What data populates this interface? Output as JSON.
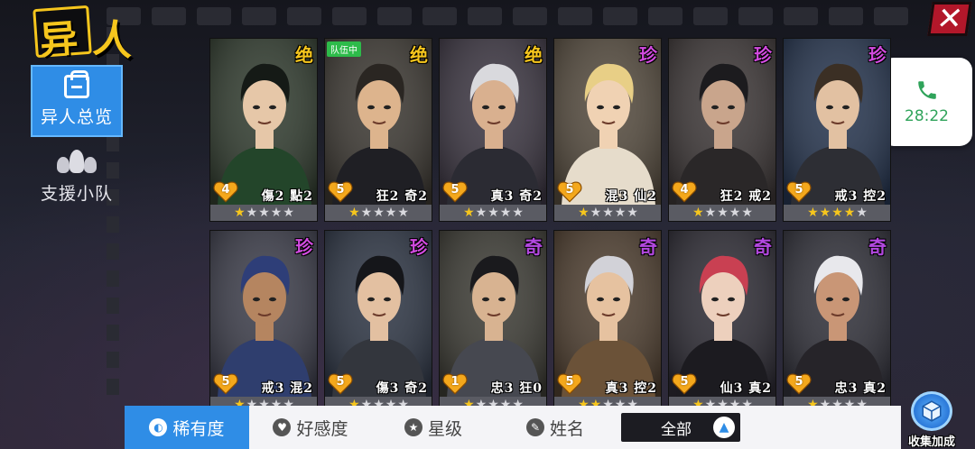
{
  "logo": {
    "char1": "异",
    "char2": "人"
  },
  "sidebar": {
    "items": [
      {
        "label": "异人总览",
        "icon": "document-icon",
        "active": true
      },
      {
        "label": "支援小队",
        "icon": "group-icon",
        "active": false
      }
    ]
  },
  "call_widget": {
    "time": "28:22",
    "icon": "phone-icon"
  },
  "close": {
    "label": "✕"
  },
  "colors": {
    "accent": "#2f8de6",
    "rarity_jue": "#f6c61d",
    "rarity_zhen": "#d24be0",
    "rarity_qi": "#b348e0",
    "star_on": "#f6c61d",
    "star_off": "#d9d9de",
    "team_badge": "#2dbb4a"
  },
  "cards": [
    {
      "rarity": "绝",
      "team_badge": "",
      "affection": "4",
      "skills": "傷2 點2",
      "stars": 1,
      "palette": {
        "bg": "#2f3a2d",
        "hair": "#151a16",
        "skin": "#e6c7a8",
        "cloth": "#23452a"
      }
    },
    {
      "rarity": "绝",
      "team_badge": "队伍中",
      "affection": "5",
      "skills": "狂2 奇2",
      "stars": 1,
      "palette": {
        "bg": "#3a3630",
        "hair": "#2a2622",
        "skin": "#ddb48d",
        "cloth": "#1f1f24"
      }
    },
    {
      "rarity": "绝",
      "team_badge": "",
      "affection": "5",
      "skills": "真3 奇2",
      "stars": 1,
      "palette": {
        "bg": "#3a3440",
        "hair": "#d9d9dd",
        "skin": "#d9b08f",
        "cloth": "#2b2b33"
      }
    },
    {
      "rarity": "珍",
      "team_badge": "",
      "affection": "5",
      "skills": "混3 仙2",
      "stars": 1,
      "palette": {
        "bg": "#53493c",
        "hair": "#e8cf86",
        "skin": "#f0d2b3",
        "cloth": "#e6dccb"
      }
    },
    {
      "rarity": "珍",
      "team_badge": "",
      "affection": "4",
      "skills": "狂2 戒2",
      "stars": 1,
      "palette": {
        "bg": "#3b3535",
        "hair": "#1c1b1e",
        "skin": "#c9a58c",
        "cloth": "#2a2728"
      }
    },
    {
      "rarity": "珍",
      "team_badge": "",
      "affection": "5",
      "skills": "戒3 控2",
      "stars": 4,
      "palette": {
        "bg": "#24334d",
        "hair": "#3b2f24",
        "skin": "#e2c1a2",
        "cloth": "#2d2e34"
      }
    },
    {
      "rarity": "珍",
      "team_badge": "",
      "affection": "5",
      "skills": "戒3 混2",
      "stars": 1,
      "palette": {
        "bg": "#3a3b48",
        "hair": "#2e3e78",
        "skin": "#b58560",
        "cloth": "#2f3e6e"
      }
    },
    {
      "rarity": "珍",
      "team_badge": "",
      "affection": "5",
      "skills": "傷3 奇2",
      "stars": 1,
      "palette": {
        "bg": "#2c3443",
        "hair": "#15161a",
        "skin": "#e3c0a1",
        "cloth": "#33363d"
      }
    },
    {
      "rarity": "奇",
      "team_badge": "",
      "affection": "1",
      "skills": "忠3 狂0",
      "stars": 1,
      "palette": {
        "bg": "#3b3a33",
        "hair": "#1a1a1d",
        "skin": "#d8b391",
        "cloth": "#464850"
      }
    },
    {
      "rarity": "奇",
      "team_badge": "",
      "affection": "5",
      "skills": "真3 控2",
      "stars": 2,
      "palette": {
        "bg": "#4d3d2e",
        "hair": "#d2d2d8",
        "skin": "#e6c2a0",
        "cloth": "#6b5238"
      }
    },
    {
      "rarity": "奇",
      "team_badge": "",
      "affection": "5",
      "skills": "仙3 真2",
      "stars": 1,
      "palette": {
        "bg": "#2c2a33",
        "hair": "#c94052",
        "skin": "#edd0bd",
        "cloth": "#1c1b20"
      }
    },
    {
      "rarity": "奇",
      "team_badge": "",
      "affection": "5",
      "skills": "忠3 真2",
      "stars": 1,
      "palette": {
        "bg": "#2f2f38",
        "hair": "#e8e8ec",
        "skin": "#c99676",
        "cloth": "#262429"
      }
    }
  ],
  "sort_tabs": [
    {
      "label": "稀有度",
      "icon": "rarity-icon",
      "active": true
    },
    {
      "label": "好感度",
      "icon": "heart-icon",
      "active": false
    },
    {
      "label": "星级",
      "icon": "star-icon",
      "active": false
    },
    {
      "label": "姓名",
      "icon": "name-icon",
      "active": false
    }
  ],
  "filter": {
    "label": "全部",
    "icon": "arrow-up-icon"
  },
  "collect_bonus": {
    "label": "收集加成",
    "icon": "cube-icon"
  }
}
